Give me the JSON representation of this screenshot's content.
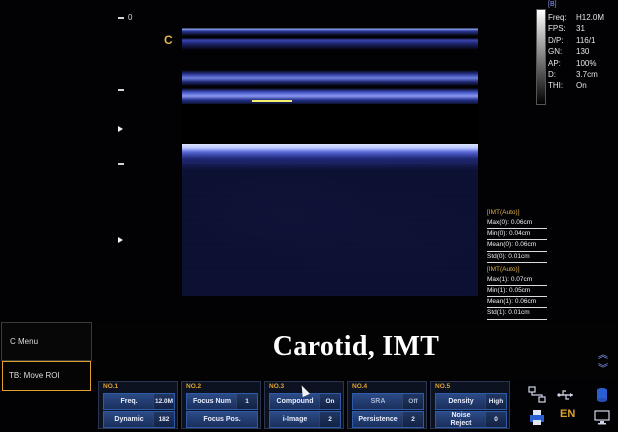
{
  "image": {
    "depth_zero_label": "0",
    "orientation_marker": "C"
  },
  "gray_bar": {
    "label": "[B]"
  },
  "params": [
    {
      "key": "Freq:",
      "value": "H12.0M"
    },
    {
      "key": "FPS:",
      "value": "31"
    },
    {
      "key": "D/P:",
      "value": "116/1"
    },
    {
      "key": "GN:",
      "value": "130"
    },
    {
      "key": "AP:",
      "value": "100%"
    },
    {
      "key": "D:",
      "value": "3.7cm"
    },
    {
      "key": "THI:",
      "value": "On"
    }
  ],
  "imt": [
    {
      "title": "[IMT(Auto)]",
      "lines": [
        "Max(0): 0.06cm",
        "Min(0): 0.04cm",
        "Mean(0): 0.06cm",
        "Std(0): 0.01cm"
      ]
    },
    {
      "title": "[IMT(Auto)]",
      "lines": [
        "Max(1): 0.07cm",
        "Min(1): 0.05cm",
        "Mean(1): 0.06cm",
        "Std(1): 0.01cm"
      ]
    }
  ],
  "menu": {
    "c_menu": "C Menu",
    "tb_move": "TB: Move ROI"
  },
  "title": "Carotid, IMT",
  "panels": [
    {
      "no": "NO.1",
      "row1": {
        "left": "Freq.",
        "right": "12.0M"
      },
      "row2": {
        "left": "Dynamic",
        "right": "182"
      }
    },
    {
      "no": "NO.2",
      "row1": {
        "left": "Focus Num",
        "right": "1"
      },
      "row2": {
        "left": "Focus Pos.",
        "right": ""
      }
    },
    {
      "no": "NO.3",
      "row1": {
        "left": "Compound",
        "right": "On"
      },
      "row2": {
        "left": "i-Image",
        "right": "2"
      }
    },
    {
      "no": "NO.4",
      "row1": {
        "left": "SRA",
        "right": "Off"
      },
      "row2": {
        "left": "Persistence",
        "right": "2"
      }
    },
    {
      "no": "NO.5",
      "row1": {
        "left": "Density",
        "right": "High"
      },
      "row2": {
        "left": "Noise\nReject",
        "right": "0"
      }
    }
  ],
  "status": {
    "language": "EN"
  },
  "icons": {
    "network": "network-icon",
    "usb": "usb-icon",
    "disk": "disk-icon",
    "printer": "printer-icon",
    "monitor": "monitor-icon"
  }
}
